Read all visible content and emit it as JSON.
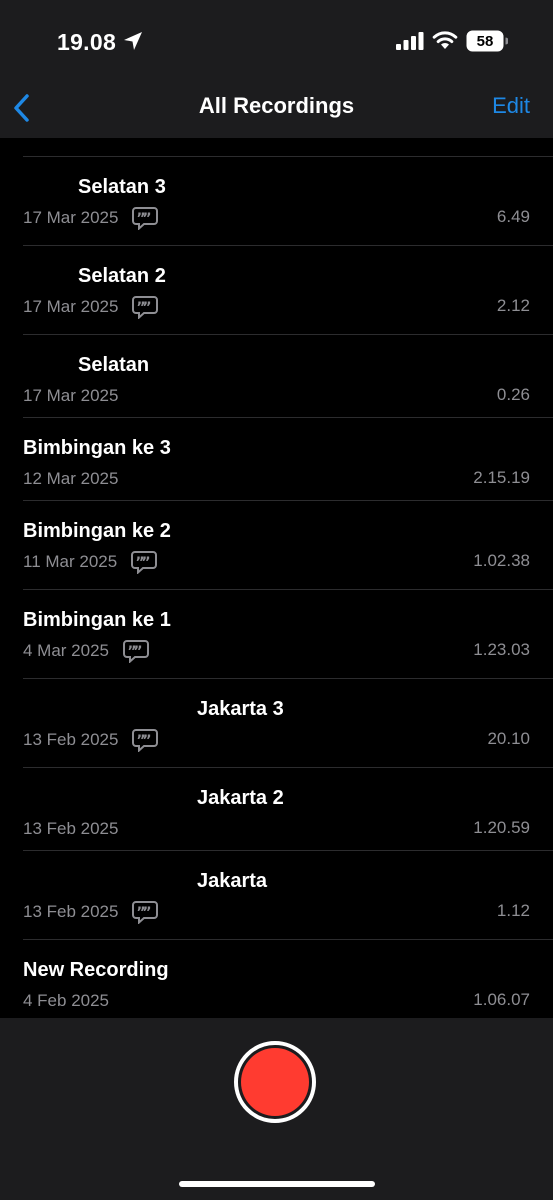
{
  "status_bar": {
    "time": "19.08",
    "battery_level": "58",
    "icons": [
      "location-arrow-icon",
      "cellular-signal-icon",
      "wifi-icon",
      "battery-icon"
    ]
  },
  "nav": {
    "back_icon": "chevron-left-icon",
    "title": "All Recordings",
    "edit_label": "Edit"
  },
  "colors": {
    "accent": "#1e88e5",
    "record": "#ff3b30",
    "secondary_text": "#8e8e93",
    "background": "#000000",
    "bar_background": "#1c1c1e"
  },
  "recordings": [
    {
      "title": "Selatan 3",
      "date": "17 Mar 2025",
      "has_transcript": true,
      "duration": "6.49"
    },
    {
      "title": "Selatan 2",
      "date": "17 Mar 2025",
      "has_transcript": true,
      "duration": "2.12"
    },
    {
      "title": "Selatan",
      "date": "17 Mar 2025",
      "has_transcript": false,
      "duration": "0.26"
    },
    {
      "title": "Bimbingan ke 3",
      "date": "12 Mar 2025",
      "has_transcript": false,
      "duration": "2.15.19"
    },
    {
      "title": "Bimbingan ke 2",
      "date": "11 Mar 2025",
      "has_transcript": true,
      "duration": "1.02.38"
    },
    {
      "title": "Bimbingan ke 1",
      "date": "4 Mar 2025",
      "has_transcript": true,
      "duration": "1.23.03"
    },
    {
      "title": "Jakarta 3",
      "date": "13 Feb 2025",
      "has_transcript": true,
      "duration": "20.10"
    },
    {
      "title": "Jakarta 2",
      "date": "13 Feb 2025",
      "has_transcript": false,
      "duration": "1.20.59"
    },
    {
      "title": "Jakarta",
      "date": "13 Feb 2025",
      "has_transcript": true,
      "duration": "1.12"
    },
    {
      "title": "New Recording",
      "date": "4 Feb 2025",
      "has_transcript": false,
      "duration": "1.06.07"
    }
  ],
  "bottom_bar": {
    "record_icon": "record-button-icon"
  }
}
